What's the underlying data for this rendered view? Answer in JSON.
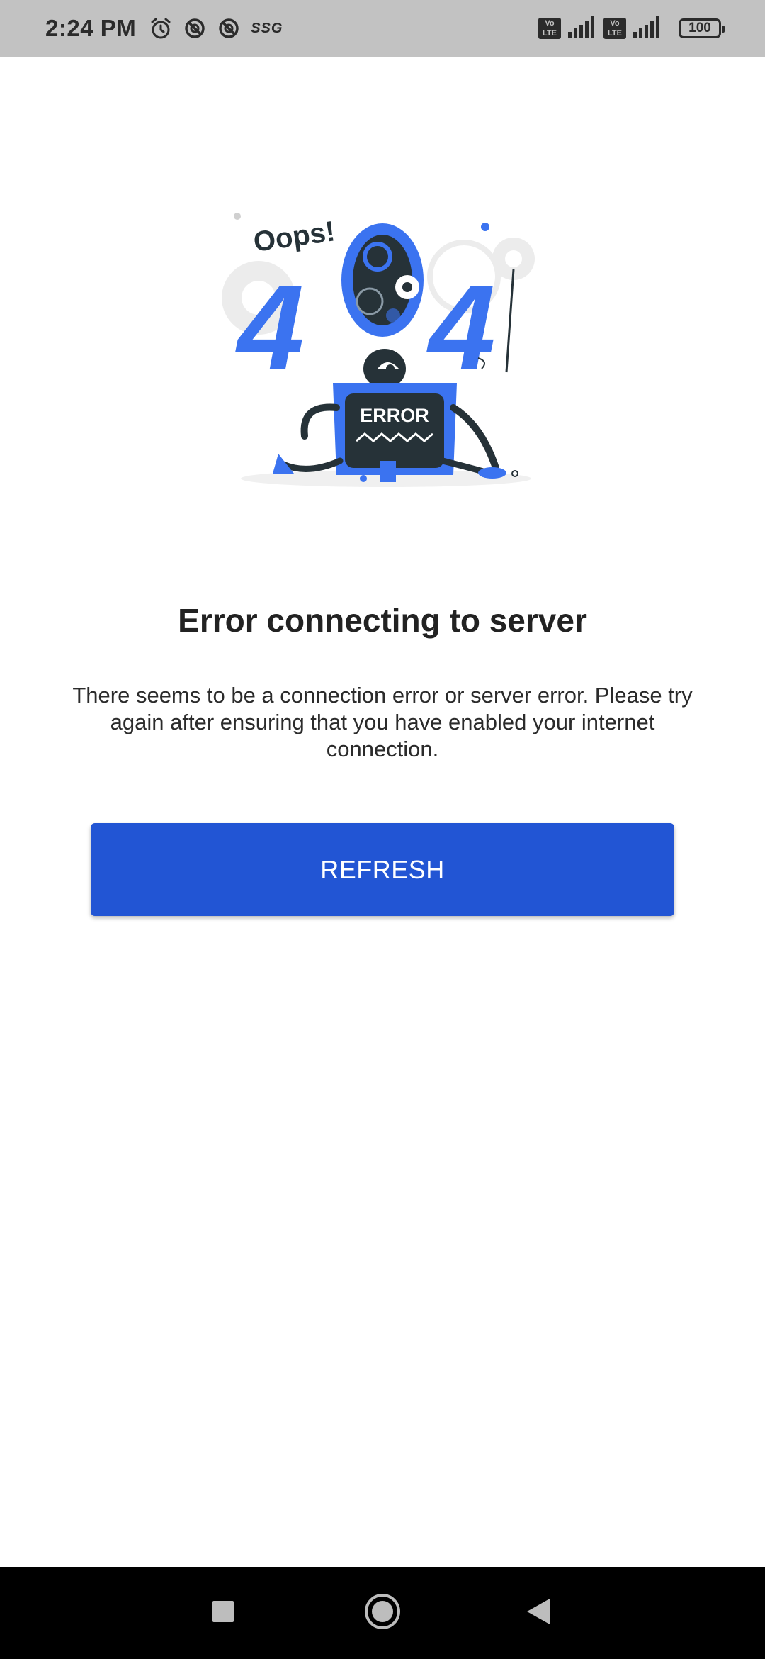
{
  "status_bar": {
    "time": "2:24 PM",
    "ssg_label": "SSG",
    "volte_1": [
      "Vo",
      "LTE"
    ],
    "volte_2": [
      "Vo",
      "LTE"
    ],
    "battery": "100"
  },
  "illustration": {
    "oops": "Oops!",
    "digit_left": "4",
    "digit_right": "4",
    "screen_label": "ERROR",
    "accent_color": "#3b73f0",
    "dark_color": "#263238"
  },
  "error": {
    "title": "Error connecting to server",
    "message": "There seems to be a connection error or server error. Please try again after ensuring that you have enabled your internet connection."
  },
  "actions": {
    "refresh_label": "REFRESH"
  },
  "colors": {
    "button": "#2255d4",
    "status_bar": "#c2c2c2",
    "nav_bar": "#000000"
  },
  "nav_bar": {
    "recents_icon": "square-icon",
    "home_icon": "circle-icon",
    "back_icon": "triangle-back-icon"
  }
}
